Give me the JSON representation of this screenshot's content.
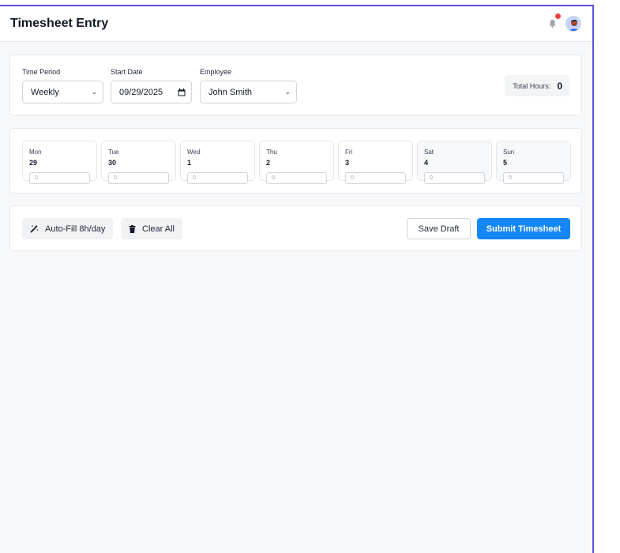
{
  "header": {
    "title": "Timesheet Entry",
    "icons": {
      "bell": "bell-icon",
      "notification_dot": "#ef4444",
      "avatar": "user-avatar"
    }
  },
  "filters": {
    "time_period": {
      "label": "Time Period",
      "value": "Weekly"
    },
    "start_date": {
      "label": "Start Date",
      "value": "09/29/2025"
    },
    "employee": {
      "label": "Employee",
      "value": "John Smith"
    },
    "total_hours": {
      "label": "Total Hours:",
      "value": "0"
    }
  },
  "days": [
    {
      "name": "Mon",
      "date": "29",
      "hours": "0"
    },
    {
      "name": "Tue",
      "date": "30",
      "hours": "0"
    },
    {
      "name": "Wed",
      "date": "1",
      "hours": "0"
    },
    {
      "name": "Thu",
      "date": "2",
      "hours": "0"
    },
    {
      "name": "Fri",
      "date": "3",
      "hours": "0"
    },
    {
      "name": "Sat",
      "date": "4",
      "hours": "0"
    },
    {
      "name": "Sun",
      "date": "5",
      "hours": "0"
    }
  ],
  "actions": {
    "auto_fill": "Auto-Fill 8h/day",
    "clear_all": "Clear All",
    "save_draft": "Save Draft",
    "submit": "Submit Timesheet"
  },
  "colors": {
    "frame_border": "#5b4fd6",
    "primary": "#1587f5",
    "page_background": "#f7f8fa"
  }
}
